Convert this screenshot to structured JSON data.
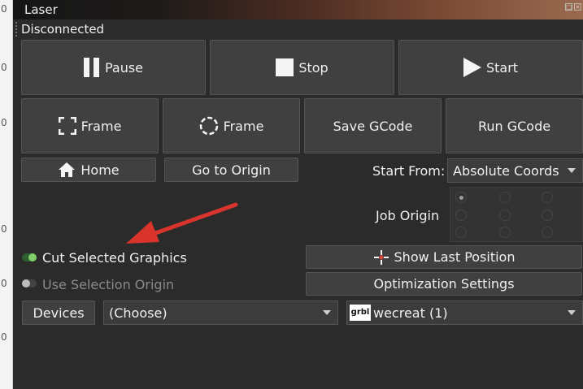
{
  "ruler": {
    "ticks": [
      "0",
      "0",
      "0",
      "0",
      "0",
      "0"
    ]
  },
  "window": {
    "title": "Laser",
    "status": "Disconnected"
  },
  "controls": {
    "pause": "Pause",
    "stop": "Stop",
    "start": "Start",
    "frame_rect": "Frame",
    "frame_circle": "Frame",
    "save_gcode": "Save GCode",
    "run_gcode": "Run GCode",
    "home": "Home",
    "go_to_origin": "Go to Origin"
  },
  "start_from": {
    "label": "Start From:",
    "value": "Absolute Coords"
  },
  "job_origin": {
    "label": "Job Origin",
    "selected_index": 0
  },
  "options": {
    "cut_selected": {
      "label": "Cut Selected Graphics",
      "enabled": true
    },
    "use_selection_origin": {
      "label": "Use Selection Origin",
      "enabled": false
    }
  },
  "buttons2": {
    "show_last_position": "Show Last Position",
    "optimization_settings": "Optimization Settings"
  },
  "devices": {
    "button": "Devices",
    "port_value": "(Choose)",
    "device_logo": "grbl",
    "device_value": "wecreat (1)"
  },
  "colors": {
    "background": "#2b2b2b",
    "button": "#404040",
    "arrow": "#d8342c",
    "toggle_on": "#7fd06a"
  }
}
